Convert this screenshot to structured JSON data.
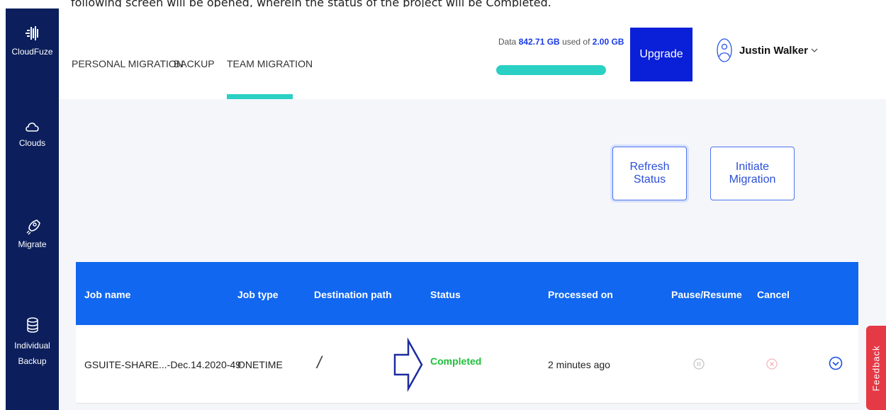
{
  "caption": "following screen will be opened, wherein the status of the project will be Completed.",
  "sidebar": {
    "logo_label": "CloudFuze",
    "items": [
      {
        "label": "Clouds",
        "icon": "cloud-icon"
      },
      {
        "label": "Migrate",
        "icon": "rocket-icon"
      },
      {
        "label": "Individual",
        "label2": "Backup",
        "icon": "database-icon"
      }
    ]
  },
  "tabs": [
    "PERSONAL MIGRATION",
    "BACKUP",
    "TEAM MIGRATION"
  ],
  "active_tab": "TEAM MIGRATION",
  "usage": {
    "prefix": "Data ",
    "used": "842.71 GB",
    "middle": " used of ",
    "total": "2.00 GB",
    "fill_fraction": 1.0
  },
  "upgrade_label": "Upgrade",
  "user": {
    "name": "Justin Walker",
    "icon": "user-icon"
  },
  "actions": {
    "refresh_label": "Refresh Status",
    "initiate_label": "Initiate Migration"
  },
  "table": {
    "headers": [
      "Job name",
      "Job type",
      "Destination path",
      "Status",
      "Processed on",
      "Pause/Resume",
      "Cancel"
    ],
    "rows": [
      {
        "job_name": "GSUITE-SHARE...-Dec.14.2020-49",
        "job_type": "ONETIME",
        "destination": "/",
        "status": "Completed",
        "processed_on": "2 minutes ago"
      }
    ]
  },
  "feedback_label": "Feedback",
  "colors": {
    "sidebar": "#0c1f5c",
    "accent": "#2bd0c4",
    "header": "#1167f0",
    "upgrade": "#0a1fd8",
    "success": "#1fbf3a",
    "feedback": "#e63946"
  }
}
